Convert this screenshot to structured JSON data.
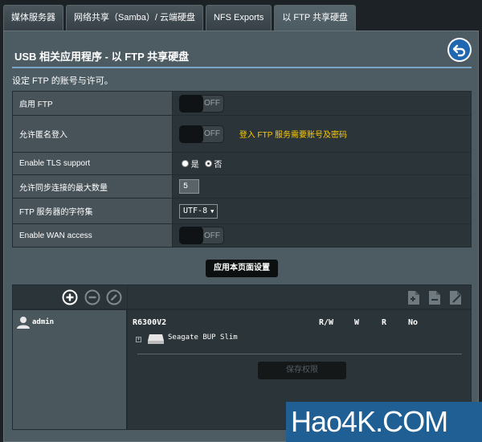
{
  "tabs": [
    {
      "label": "媒体服务器"
    },
    {
      "label": "网络共享（Samba）/ 云端硬盘"
    },
    {
      "label": "NFS Exports"
    },
    {
      "label": "以 FTP 共享硬盘"
    }
  ],
  "page": {
    "title": "USB 相关应用程序 - 以 FTP 共享硬盘",
    "subtitle": "设定 FTP 的账号与许可。"
  },
  "settings": {
    "enable_ftp": {
      "label": "启用 FTP",
      "state": "OFF"
    },
    "anonymous": {
      "label": "允许匿名登入",
      "state": "OFF",
      "hint": "登入 FTP 服务需要账号及密码"
    },
    "tls": {
      "label": "Enable TLS support",
      "yes": "是",
      "no": "否"
    },
    "max_conn": {
      "label": "允许同步连接的最大数量",
      "value": "5"
    },
    "charset": {
      "label": "FTP 服务器的字符集",
      "value": "UTF-8"
    },
    "wan": {
      "label": "Enable WAN access",
      "state": "OFF"
    }
  },
  "apply_label": "应用本页面设置",
  "accounts": {
    "user": "admin",
    "device": "R6300V2",
    "columns": [
      "R/W",
      "W",
      "R",
      "No"
    ],
    "disk": "Seagate BUP Slim",
    "save_label": "保存权限"
  },
  "watermark": {
    "text": "Hao4K",
    "suffix": ".COM"
  },
  "colors": {
    "accent_blue": "#1f67b1",
    "hint_yellow": "#ffcc00",
    "panel": "#4d5b62"
  }
}
